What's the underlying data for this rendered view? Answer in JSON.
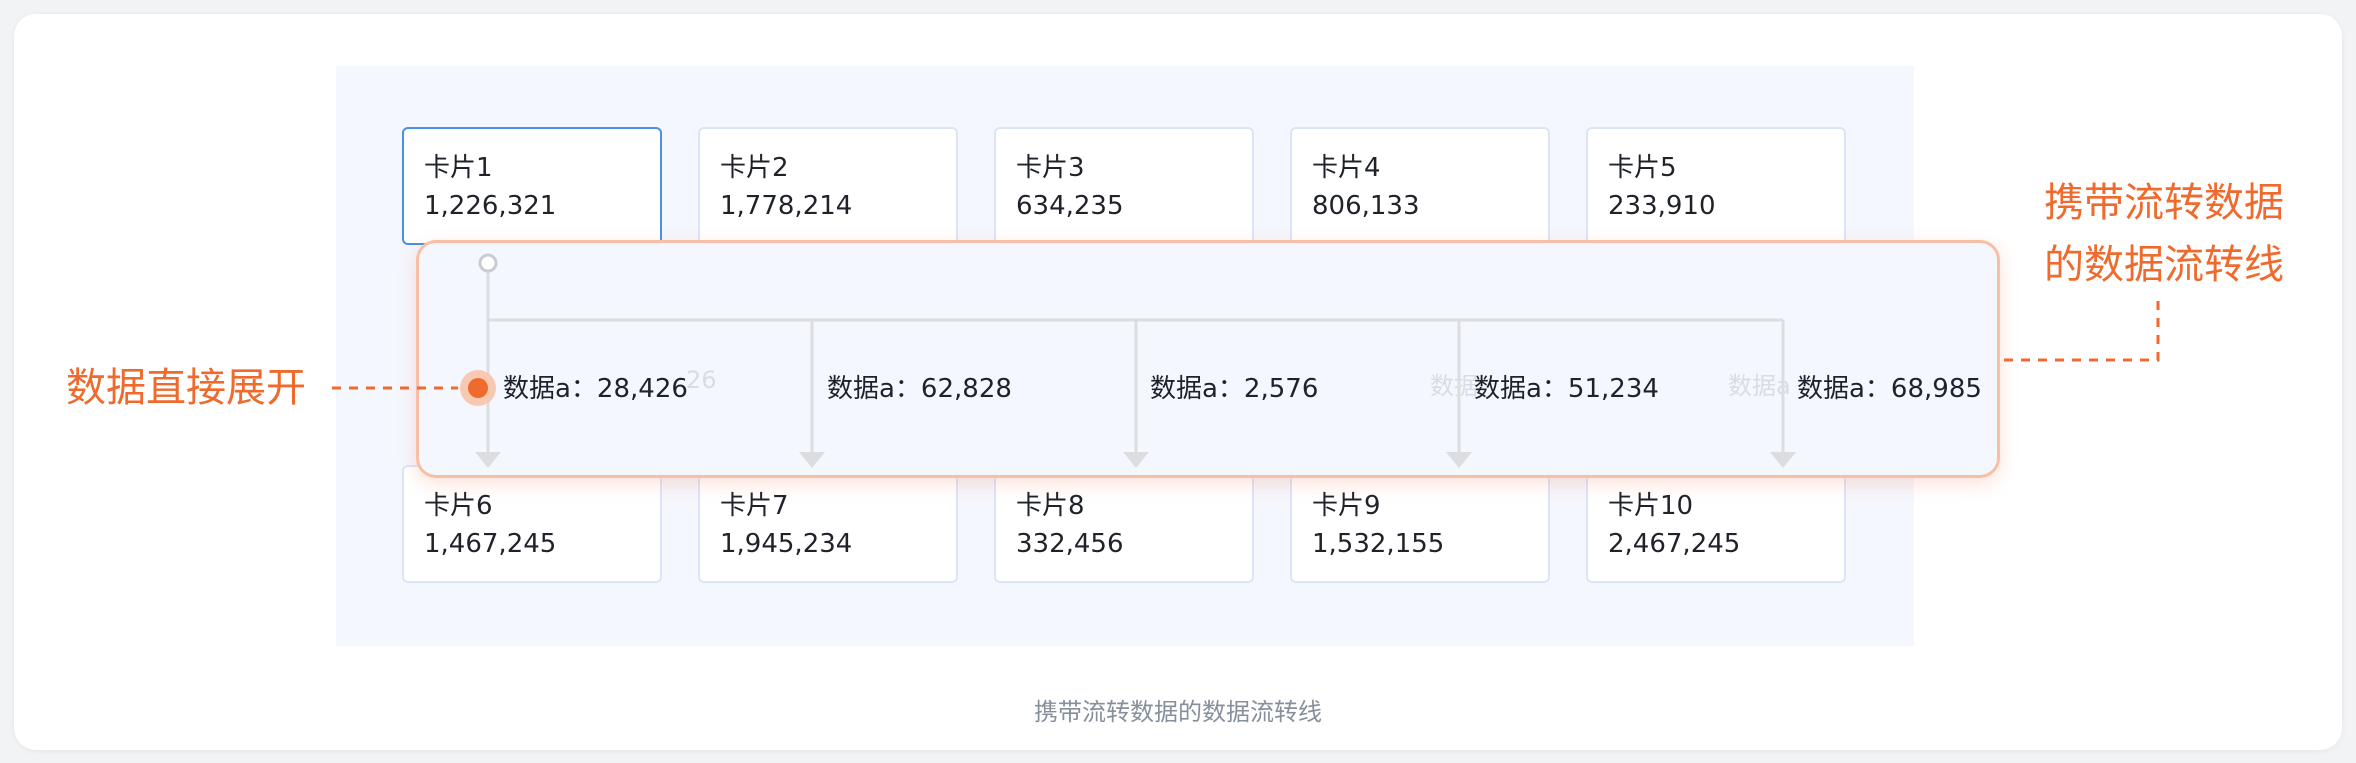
{
  "cards_top": [
    {
      "name": "卡片1",
      "value": "1,226,321"
    },
    {
      "name": "卡片2",
      "value": "1,778,214"
    },
    {
      "name": "卡片3",
      "value": "634,235"
    },
    {
      "name": "卡片4",
      "value": "806,133"
    },
    {
      "name": "卡片5",
      "value": "233,910"
    }
  ],
  "cards_bottom": [
    {
      "name": "卡片6",
      "value": "1,467,245"
    },
    {
      "name": "卡片7",
      "value": "1,945,234"
    },
    {
      "name": "卡片8",
      "value": "332,456"
    },
    {
      "name": "卡片9",
      "value": "1,532,155"
    },
    {
      "name": "卡片10",
      "value": "2,467,245"
    }
  ],
  "flow_labels": [
    "数据a：28,426",
    "数据a：62,828",
    "数据a：2,576",
    "数据a：51,234",
    "数据a：68,985"
  ],
  "ghost_labels": [
    "26",
    "数据",
    "数据a"
  ],
  "annotations": {
    "left": "数据直接展开",
    "right_line1": "携带流转数据",
    "right_line2": "的数据流转线"
  },
  "caption": "携带流转数据的数据流转线",
  "colors": {
    "accent": "#ef6a2d",
    "selected_border": "#4a8fe8",
    "card_border": "#dbe5f6",
    "panel_border": "#f9bfa6"
  }
}
